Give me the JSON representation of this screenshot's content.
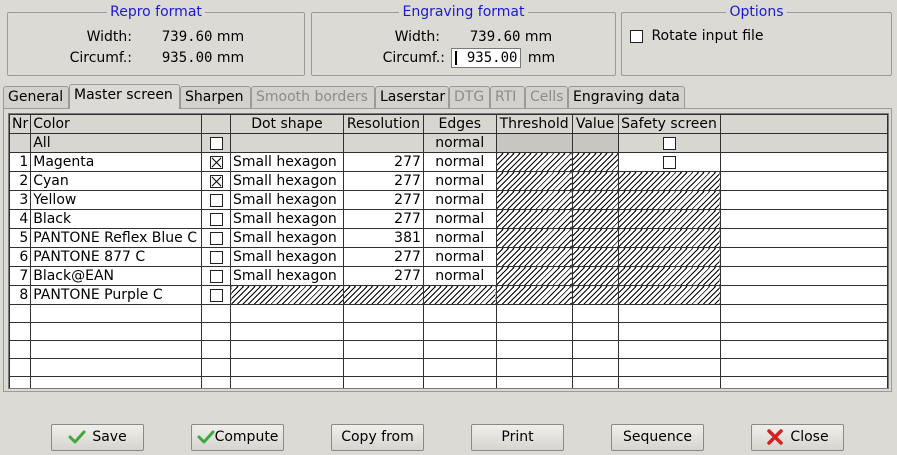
{
  "repro": {
    "title": "Repro format",
    "width_label": "Width:",
    "width_value": "739.60",
    "circ_label": "Circumf.:",
    "circ_value": "935.00",
    "unit": "mm"
  },
  "engraving": {
    "title": "Engraving format",
    "width_label": "Width:",
    "width_value": "739.60",
    "circ_label": "Circumf.:",
    "circ_value": "935.00",
    "unit": "mm"
  },
  "options": {
    "title": "Options",
    "rotate_label": "Rotate input file"
  },
  "tabs": [
    {
      "label": "General",
      "state": "normal"
    },
    {
      "label": "Master screen",
      "state": "active"
    },
    {
      "label": "Sharpen",
      "state": "normal"
    },
    {
      "label": "Smooth borders",
      "state": "disabled"
    },
    {
      "label": "Laserstar",
      "state": "normal"
    },
    {
      "label": "DTG",
      "state": "disabled"
    },
    {
      "label": "RTI",
      "state": "disabled"
    },
    {
      "label": "Cells",
      "state": "disabled"
    },
    {
      "label": "Engraving data",
      "state": "normal"
    }
  ],
  "table": {
    "columns": [
      "Nr",
      "Color",
      "",
      "Dot shape",
      "Resolution",
      "Edges",
      "Threshold",
      "Value",
      "Safety screen"
    ],
    "all_row": {
      "color": "All",
      "edges": "normal"
    },
    "rows": [
      {
        "nr": "1",
        "color": "Magenta",
        "checked": true,
        "dot_shape": "Small hexagon",
        "resolution": "277",
        "edges": "normal",
        "safety": "checkbox"
      },
      {
        "nr": "2",
        "color": "Cyan",
        "checked": true,
        "dot_shape": "Small hexagon",
        "resolution": "277",
        "edges": "normal",
        "safety": "hatch"
      },
      {
        "nr": "3",
        "color": "Yellow",
        "checked": false,
        "dot_shape": "Small hexagon",
        "resolution": "277",
        "edges": "normal",
        "safety": "hatch"
      },
      {
        "nr": "4",
        "color": "Black",
        "checked": false,
        "dot_shape": "Small hexagon",
        "resolution": "277",
        "edges": "normal",
        "safety": "hatch"
      },
      {
        "nr": "5",
        "color": "PANTONE Reflex Blue C",
        "checked": false,
        "dot_shape": "Small hexagon",
        "resolution": "381",
        "edges": "normal",
        "safety": "hatch"
      },
      {
        "nr": "6",
        "color": "PANTONE 877 C",
        "checked": false,
        "dot_shape": "Small hexagon",
        "resolution": "277",
        "edges": "normal",
        "safety": "hatch"
      },
      {
        "nr": "7",
        "color": "Black@EAN",
        "checked": false,
        "dot_shape": "Small hexagon",
        "resolution": "277",
        "edges": "normal",
        "safety": "hatch"
      },
      {
        "nr": "8",
        "color": "PANTONE Purple C",
        "checked": false,
        "dot_shape": "",
        "resolution": "",
        "edges": "",
        "safety": "hatch",
        "all_hatch": true
      }
    ]
  },
  "buttons": {
    "save": "Save",
    "compute": "Compute",
    "copy_from": "Copy from",
    "print": "Print",
    "sequence": "Sequence",
    "close": "Close"
  },
  "icons": {
    "save": "green-check-icon",
    "compute": "green-check-icon",
    "close": "red-x-icon"
  },
  "colors": {
    "group_title": "#1a1ad0",
    "background": "#dcdad5",
    "check_green": "#3fa83c",
    "close_red": "#d42020"
  }
}
